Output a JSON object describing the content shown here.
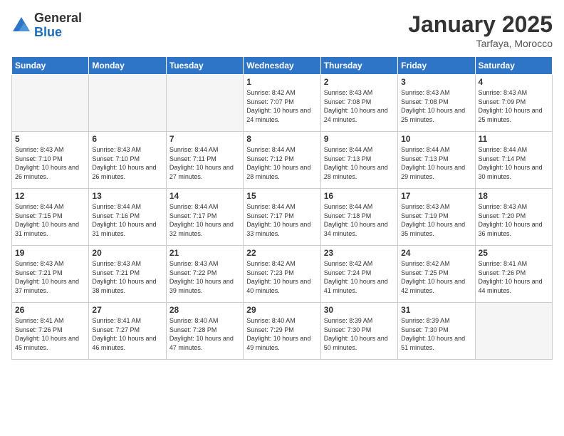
{
  "logo": {
    "general": "General",
    "blue": "Blue"
  },
  "title": "January 2025",
  "location": "Tarfaya, Morocco",
  "headers": [
    "Sunday",
    "Monday",
    "Tuesday",
    "Wednesday",
    "Thursday",
    "Friday",
    "Saturday"
  ],
  "weeks": [
    [
      {
        "day": "",
        "info": ""
      },
      {
        "day": "",
        "info": ""
      },
      {
        "day": "",
        "info": ""
      },
      {
        "day": "1",
        "info": "Sunrise: 8:42 AM\nSunset: 7:07 PM\nDaylight: 10 hours\nand 24 minutes."
      },
      {
        "day": "2",
        "info": "Sunrise: 8:43 AM\nSunset: 7:08 PM\nDaylight: 10 hours\nand 24 minutes."
      },
      {
        "day": "3",
        "info": "Sunrise: 8:43 AM\nSunset: 7:08 PM\nDaylight: 10 hours\nand 25 minutes."
      },
      {
        "day": "4",
        "info": "Sunrise: 8:43 AM\nSunset: 7:09 PM\nDaylight: 10 hours\nand 25 minutes."
      }
    ],
    [
      {
        "day": "5",
        "info": "Sunrise: 8:43 AM\nSunset: 7:10 PM\nDaylight: 10 hours\nand 26 minutes."
      },
      {
        "day": "6",
        "info": "Sunrise: 8:43 AM\nSunset: 7:10 PM\nDaylight: 10 hours\nand 26 minutes."
      },
      {
        "day": "7",
        "info": "Sunrise: 8:44 AM\nSunset: 7:11 PM\nDaylight: 10 hours\nand 27 minutes."
      },
      {
        "day": "8",
        "info": "Sunrise: 8:44 AM\nSunset: 7:12 PM\nDaylight: 10 hours\nand 28 minutes."
      },
      {
        "day": "9",
        "info": "Sunrise: 8:44 AM\nSunset: 7:13 PM\nDaylight: 10 hours\nand 28 minutes."
      },
      {
        "day": "10",
        "info": "Sunrise: 8:44 AM\nSunset: 7:13 PM\nDaylight: 10 hours\nand 29 minutes."
      },
      {
        "day": "11",
        "info": "Sunrise: 8:44 AM\nSunset: 7:14 PM\nDaylight: 10 hours\nand 30 minutes."
      }
    ],
    [
      {
        "day": "12",
        "info": "Sunrise: 8:44 AM\nSunset: 7:15 PM\nDaylight: 10 hours\nand 31 minutes."
      },
      {
        "day": "13",
        "info": "Sunrise: 8:44 AM\nSunset: 7:16 PM\nDaylight: 10 hours\nand 31 minutes."
      },
      {
        "day": "14",
        "info": "Sunrise: 8:44 AM\nSunset: 7:17 PM\nDaylight: 10 hours\nand 32 minutes."
      },
      {
        "day": "15",
        "info": "Sunrise: 8:44 AM\nSunset: 7:17 PM\nDaylight: 10 hours\nand 33 minutes."
      },
      {
        "day": "16",
        "info": "Sunrise: 8:44 AM\nSunset: 7:18 PM\nDaylight: 10 hours\nand 34 minutes."
      },
      {
        "day": "17",
        "info": "Sunrise: 8:43 AM\nSunset: 7:19 PM\nDaylight: 10 hours\nand 35 minutes."
      },
      {
        "day": "18",
        "info": "Sunrise: 8:43 AM\nSunset: 7:20 PM\nDaylight: 10 hours\nand 36 minutes."
      }
    ],
    [
      {
        "day": "19",
        "info": "Sunrise: 8:43 AM\nSunset: 7:21 PM\nDaylight: 10 hours\nand 37 minutes."
      },
      {
        "day": "20",
        "info": "Sunrise: 8:43 AM\nSunset: 7:21 PM\nDaylight: 10 hours\nand 38 minutes."
      },
      {
        "day": "21",
        "info": "Sunrise: 8:43 AM\nSunset: 7:22 PM\nDaylight: 10 hours\nand 39 minutes."
      },
      {
        "day": "22",
        "info": "Sunrise: 8:42 AM\nSunset: 7:23 PM\nDaylight: 10 hours\nand 40 minutes."
      },
      {
        "day": "23",
        "info": "Sunrise: 8:42 AM\nSunset: 7:24 PM\nDaylight: 10 hours\nand 41 minutes."
      },
      {
        "day": "24",
        "info": "Sunrise: 8:42 AM\nSunset: 7:25 PM\nDaylight: 10 hours\nand 42 minutes."
      },
      {
        "day": "25",
        "info": "Sunrise: 8:41 AM\nSunset: 7:26 PM\nDaylight: 10 hours\nand 44 minutes."
      }
    ],
    [
      {
        "day": "26",
        "info": "Sunrise: 8:41 AM\nSunset: 7:26 PM\nDaylight: 10 hours\nand 45 minutes."
      },
      {
        "day": "27",
        "info": "Sunrise: 8:41 AM\nSunset: 7:27 PM\nDaylight: 10 hours\nand 46 minutes."
      },
      {
        "day": "28",
        "info": "Sunrise: 8:40 AM\nSunset: 7:28 PM\nDaylight: 10 hours\nand 47 minutes."
      },
      {
        "day": "29",
        "info": "Sunrise: 8:40 AM\nSunset: 7:29 PM\nDaylight: 10 hours\nand 49 minutes."
      },
      {
        "day": "30",
        "info": "Sunrise: 8:39 AM\nSunset: 7:30 PM\nDaylight: 10 hours\nand 50 minutes."
      },
      {
        "day": "31",
        "info": "Sunrise: 8:39 AM\nSunset: 7:30 PM\nDaylight: 10 hours\nand 51 minutes."
      },
      {
        "day": "",
        "info": ""
      }
    ]
  ]
}
